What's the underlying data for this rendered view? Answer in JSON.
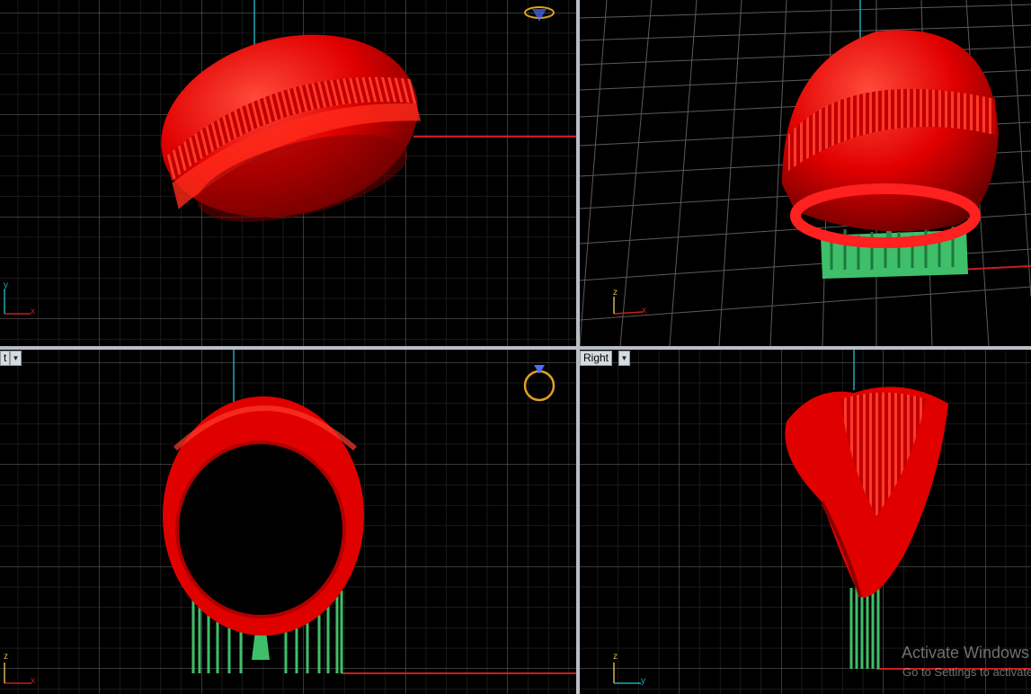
{
  "viewports": {
    "top": {
      "axis_h": "x",
      "axis_v": "y"
    },
    "perspective": {
      "axis_h": "x",
      "axis_v": "z"
    },
    "front": {
      "label_fragment": "t",
      "axis_h": "x",
      "axis_v": "z"
    },
    "right": {
      "label": "Right",
      "axis_h": "y",
      "axis_v": "z"
    }
  },
  "icons": {
    "top_corner": "ring-top-view-icon",
    "front_corner": "ring-front-view-icon",
    "dropdown": "triangle-down-icon"
  },
  "dropdown_glyph": "▼",
  "watermark": {
    "title": "Activate Windows",
    "subtitle": "Go to Settings to activate Windows."
  },
  "colors": {
    "background": "#000000",
    "grid_minor": "#2c2c2c",
    "grid_major": "#6a6a6a",
    "model_red": "#e00000",
    "support_green": "#3fbf6a",
    "axis_x": "#c81e1e",
    "axis_y": "#1fa8b8",
    "axis_z": "#d8b24a"
  }
}
